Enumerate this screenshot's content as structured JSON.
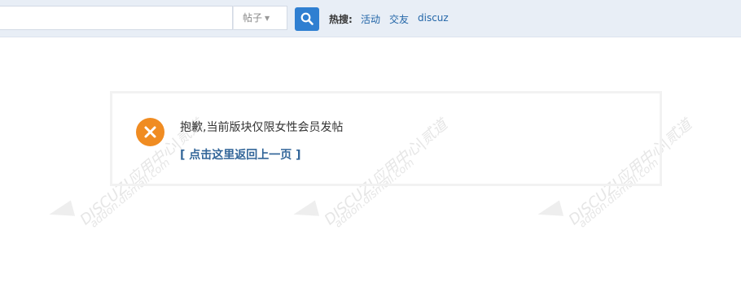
{
  "search": {
    "input_value": "",
    "type_label": "帖子",
    "button_icon": "search-icon",
    "hot_label": "热搜:",
    "hot_links": [
      "活动",
      "交友",
      "discuz"
    ]
  },
  "message": {
    "text": "抱歉,当前版块仅限女性会员发帖",
    "back_link": "[ 点击这里返回上一页 ]",
    "icon": "error-x-icon"
  },
  "watermark": {
    "brand": "DISCUZ!应用中心|贰道",
    "domain": "addon.dismall.com"
  },
  "colors": {
    "accent": "#2f7fd1",
    "link": "#336699",
    "error": "#f08c22"
  }
}
